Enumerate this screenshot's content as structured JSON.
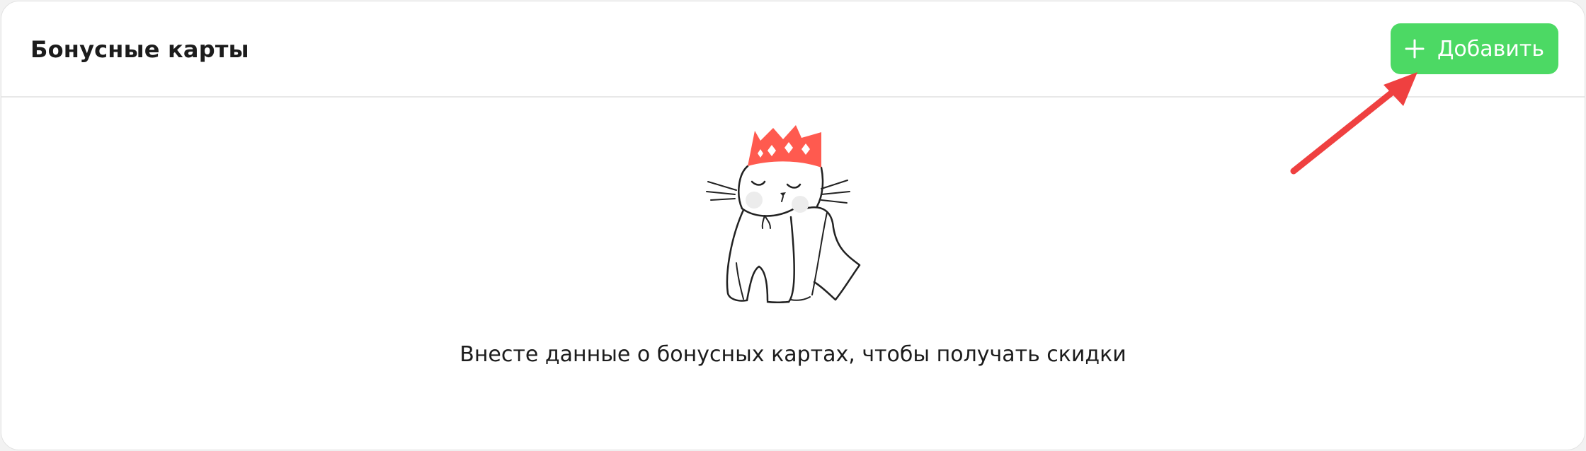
{
  "header": {
    "title": "Бонусные карты",
    "add_button_label": "Добавить"
  },
  "empty_state": {
    "message": "Внесте данные о бонусных картах, чтобы получать скидки"
  },
  "icons": {
    "add": "plus-icon",
    "illustration": "cat-with-crown-illustration",
    "annotation": "red-arrow-icon"
  },
  "colors": {
    "accent": "#4cd964",
    "crown": "#ff5a4f",
    "annotation": "#ef4040"
  }
}
